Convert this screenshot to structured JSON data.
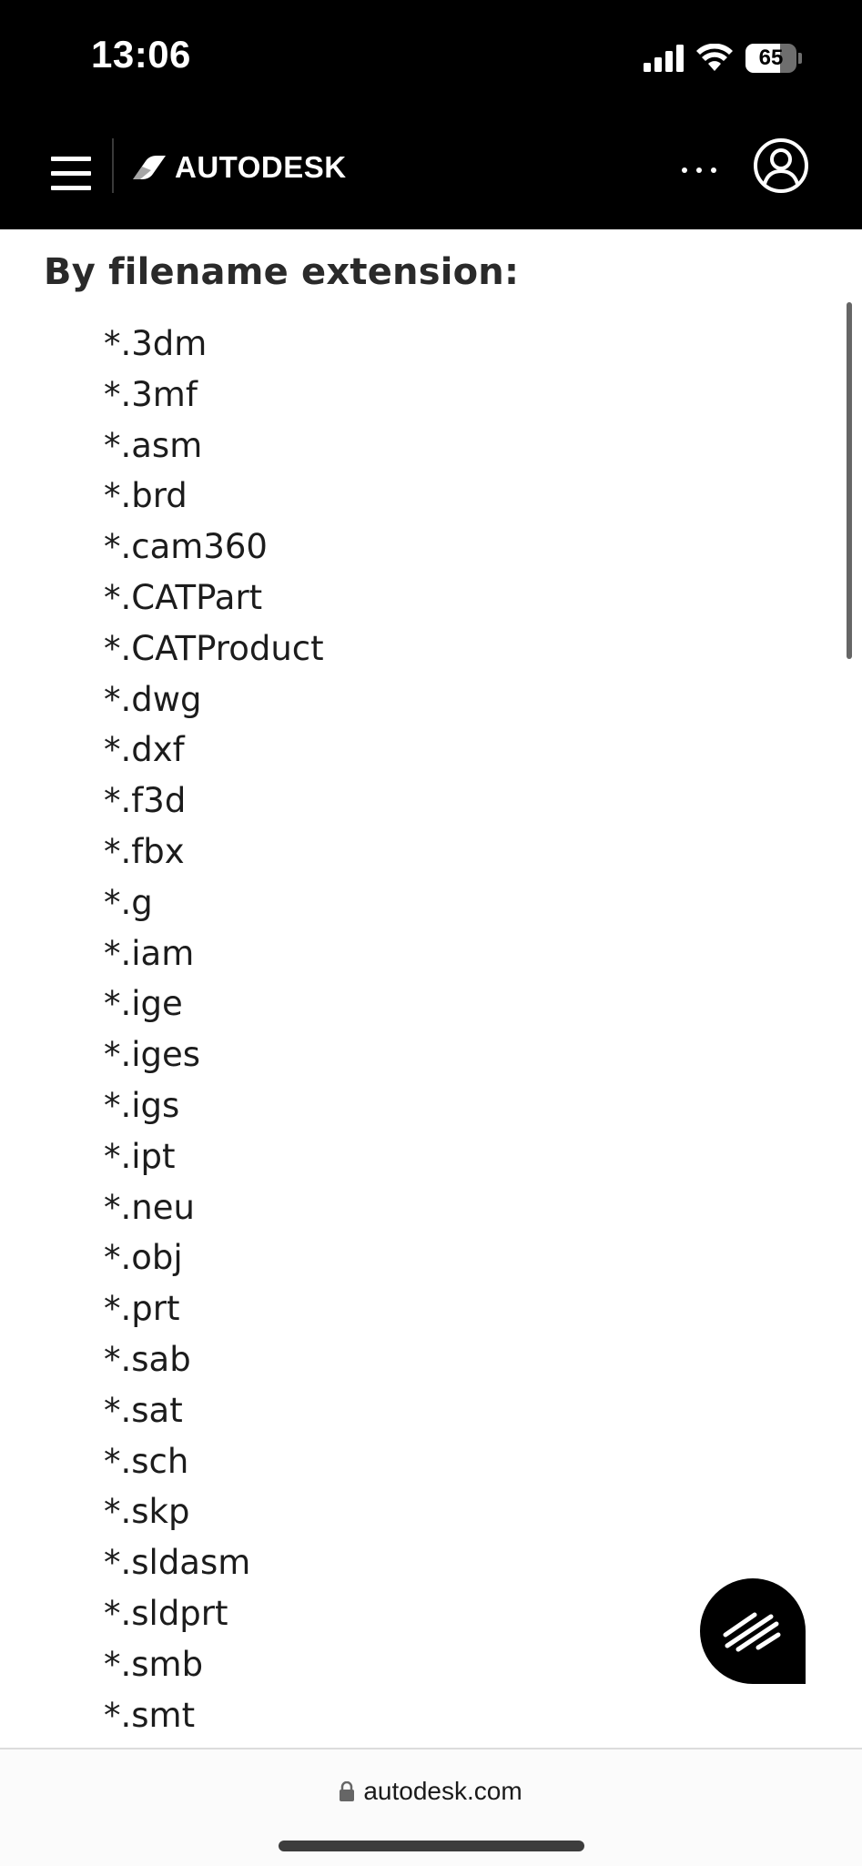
{
  "status_bar": {
    "time": "13:06",
    "battery": "65"
  },
  "nav": {
    "brand": "AUTODESK",
    "icons": [
      "hamburger-menu-icon",
      "autodesk-logo-icon",
      "more-horizontal-icon",
      "account-icon"
    ]
  },
  "content": {
    "section_title": "By filename extension:",
    "extensions": [
      "*.3dm",
      "*.3mf",
      "*.asm",
      "*.brd",
      "*.cam360",
      "*.CATPart",
      "*.CATProduct",
      "*.dwg",
      "*.dxf",
      "*.f3d",
      "*.fbx",
      "*.g",
      "*.iam",
      "*.ige",
      "*.iges",
      "*.igs",
      "*.ipt",
      "*.neu",
      "*.obj",
      "*.prt",
      "*.sab",
      "*.sat",
      "*.sch",
      "*.skp",
      "*.sldasm",
      "*.sldprt",
      "*.smb",
      "*.smt"
    ]
  },
  "browser": {
    "url": "autodesk.com"
  },
  "colors": {
    "header_bg": "#000000",
    "page_bg": "#ffffff",
    "text": "#1c1c1c"
  }
}
